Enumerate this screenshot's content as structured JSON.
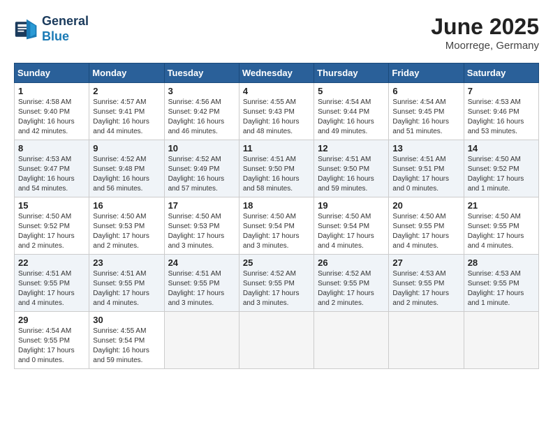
{
  "header": {
    "logo_line1": "General",
    "logo_line2": "Blue",
    "month_title": "June 2025",
    "location": "Moorrege, Germany"
  },
  "days_of_week": [
    "Sunday",
    "Monday",
    "Tuesday",
    "Wednesday",
    "Thursday",
    "Friday",
    "Saturday"
  ],
  "weeks": [
    [
      {
        "day": "1",
        "info": "Sunrise: 4:58 AM\nSunset: 9:40 PM\nDaylight: 16 hours\nand 42 minutes."
      },
      {
        "day": "2",
        "info": "Sunrise: 4:57 AM\nSunset: 9:41 PM\nDaylight: 16 hours\nand 44 minutes."
      },
      {
        "day": "3",
        "info": "Sunrise: 4:56 AM\nSunset: 9:42 PM\nDaylight: 16 hours\nand 46 minutes."
      },
      {
        "day": "4",
        "info": "Sunrise: 4:55 AM\nSunset: 9:43 PM\nDaylight: 16 hours\nand 48 minutes."
      },
      {
        "day": "5",
        "info": "Sunrise: 4:54 AM\nSunset: 9:44 PM\nDaylight: 16 hours\nand 49 minutes."
      },
      {
        "day": "6",
        "info": "Sunrise: 4:54 AM\nSunset: 9:45 PM\nDaylight: 16 hours\nand 51 minutes."
      },
      {
        "day": "7",
        "info": "Sunrise: 4:53 AM\nSunset: 9:46 PM\nDaylight: 16 hours\nand 53 minutes."
      }
    ],
    [
      {
        "day": "8",
        "info": "Sunrise: 4:53 AM\nSunset: 9:47 PM\nDaylight: 16 hours\nand 54 minutes."
      },
      {
        "day": "9",
        "info": "Sunrise: 4:52 AM\nSunset: 9:48 PM\nDaylight: 16 hours\nand 56 minutes."
      },
      {
        "day": "10",
        "info": "Sunrise: 4:52 AM\nSunset: 9:49 PM\nDaylight: 16 hours\nand 57 minutes."
      },
      {
        "day": "11",
        "info": "Sunrise: 4:51 AM\nSunset: 9:50 PM\nDaylight: 16 hours\nand 58 minutes."
      },
      {
        "day": "12",
        "info": "Sunrise: 4:51 AM\nSunset: 9:50 PM\nDaylight: 16 hours\nand 59 minutes."
      },
      {
        "day": "13",
        "info": "Sunrise: 4:51 AM\nSunset: 9:51 PM\nDaylight: 17 hours\nand 0 minutes."
      },
      {
        "day": "14",
        "info": "Sunrise: 4:50 AM\nSunset: 9:52 PM\nDaylight: 17 hours\nand 1 minute."
      }
    ],
    [
      {
        "day": "15",
        "info": "Sunrise: 4:50 AM\nSunset: 9:52 PM\nDaylight: 17 hours\nand 2 minutes."
      },
      {
        "day": "16",
        "info": "Sunrise: 4:50 AM\nSunset: 9:53 PM\nDaylight: 17 hours\nand 2 minutes."
      },
      {
        "day": "17",
        "info": "Sunrise: 4:50 AM\nSunset: 9:53 PM\nDaylight: 17 hours\nand 3 minutes."
      },
      {
        "day": "18",
        "info": "Sunrise: 4:50 AM\nSunset: 9:54 PM\nDaylight: 17 hours\nand 3 minutes."
      },
      {
        "day": "19",
        "info": "Sunrise: 4:50 AM\nSunset: 9:54 PM\nDaylight: 17 hours\nand 4 minutes."
      },
      {
        "day": "20",
        "info": "Sunrise: 4:50 AM\nSunset: 9:55 PM\nDaylight: 17 hours\nand 4 minutes."
      },
      {
        "day": "21",
        "info": "Sunrise: 4:50 AM\nSunset: 9:55 PM\nDaylight: 17 hours\nand 4 minutes."
      }
    ],
    [
      {
        "day": "22",
        "info": "Sunrise: 4:51 AM\nSunset: 9:55 PM\nDaylight: 17 hours\nand 4 minutes."
      },
      {
        "day": "23",
        "info": "Sunrise: 4:51 AM\nSunset: 9:55 PM\nDaylight: 17 hours\nand 4 minutes."
      },
      {
        "day": "24",
        "info": "Sunrise: 4:51 AM\nSunset: 9:55 PM\nDaylight: 17 hours\nand 3 minutes."
      },
      {
        "day": "25",
        "info": "Sunrise: 4:52 AM\nSunset: 9:55 PM\nDaylight: 17 hours\nand 3 minutes."
      },
      {
        "day": "26",
        "info": "Sunrise: 4:52 AM\nSunset: 9:55 PM\nDaylight: 17 hours\nand 2 minutes."
      },
      {
        "day": "27",
        "info": "Sunrise: 4:53 AM\nSunset: 9:55 PM\nDaylight: 17 hours\nand 2 minutes."
      },
      {
        "day": "28",
        "info": "Sunrise: 4:53 AM\nSunset: 9:55 PM\nDaylight: 17 hours\nand 1 minute."
      }
    ],
    [
      {
        "day": "29",
        "info": "Sunrise: 4:54 AM\nSunset: 9:55 PM\nDaylight: 17 hours\nand 0 minutes."
      },
      {
        "day": "30",
        "info": "Sunrise: 4:55 AM\nSunset: 9:54 PM\nDaylight: 16 hours\nand 59 minutes."
      },
      {
        "day": "",
        "info": ""
      },
      {
        "day": "",
        "info": ""
      },
      {
        "day": "",
        "info": ""
      },
      {
        "day": "",
        "info": ""
      },
      {
        "day": "",
        "info": ""
      }
    ]
  ]
}
